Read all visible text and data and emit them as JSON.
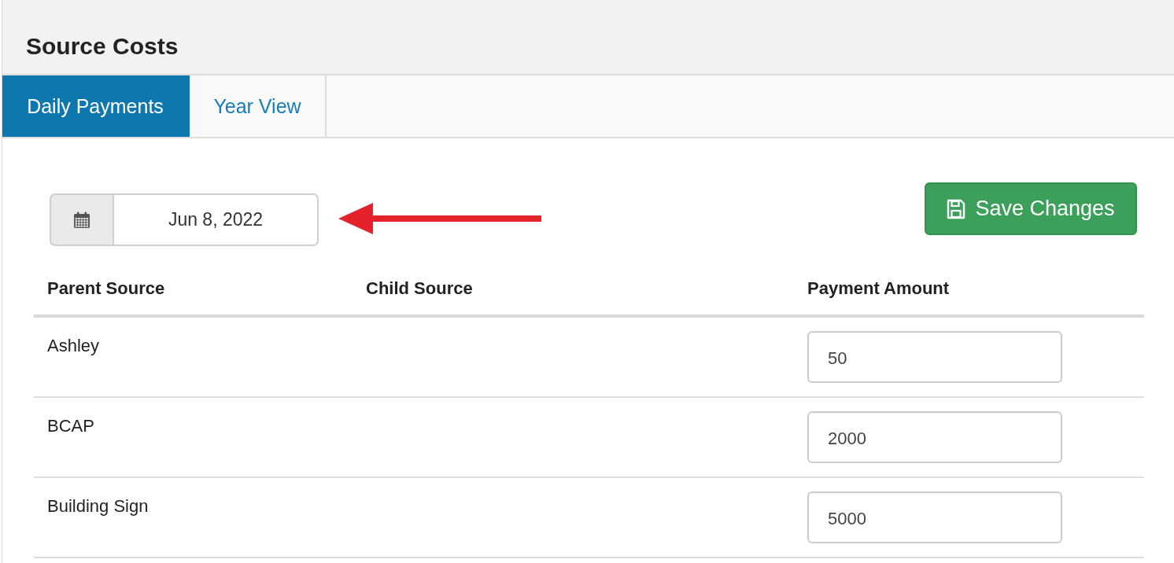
{
  "panel": {
    "title": "Source Costs"
  },
  "tabs": [
    {
      "label": "Daily Payments",
      "selected": true
    },
    {
      "label": "Year View",
      "selected": false
    }
  ],
  "date_picker": {
    "value": "Jun 8, 2022"
  },
  "save_button": {
    "label": "Save Changes"
  },
  "table": {
    "columns": [
      "Parent Source",
      "Child Source",
      "Payment Amount"
    ],
    "rows": [
      {
        "parent_source": "Ashley",
        "payment_amount": "50"
      },
      {
        "parent_source": "BCAP",
        "payment_amount": "2000"
      },
      {
        "parent_source": "Building Sign",
        "payment_amount": "5000"
      }
    ]
  }
}
